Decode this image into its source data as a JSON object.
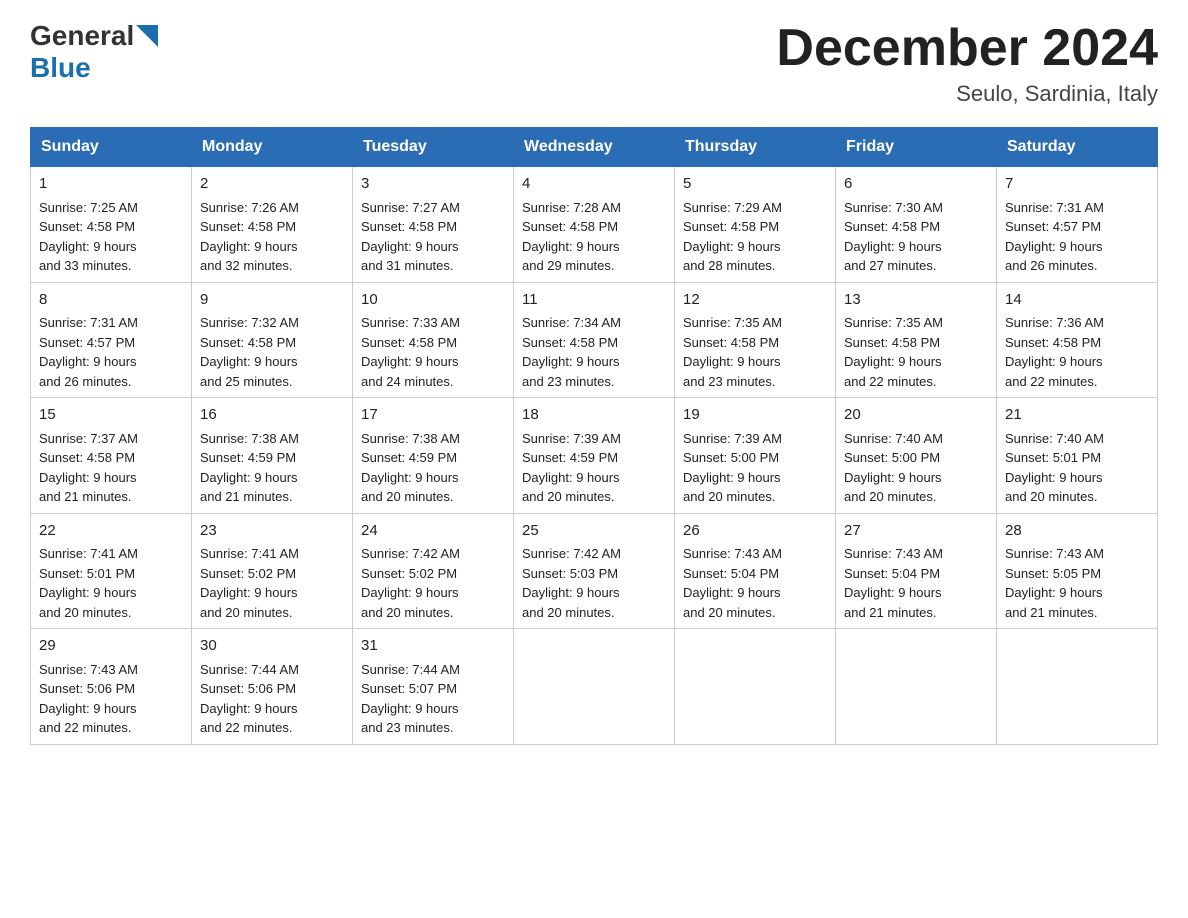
{
  "logo": {
    "general": "General",
    "blue": "Blue",
    "arrow": "▶"
  },
  "title": "December 2024",
  "location": "Seulo, Sardinia, Italy",
  "days_of_week": [
    "Sunday",
    "Monday",
    "Tuesday",
    "Wednesday",
    "Thursday",
    "Friday",
    "Saturday"
  ],
  "weeks": [
    [
      {
        "num": "1",
        "sunrise": "7:25 AM",
        "sunset": "4:58 PM",
        "daylight": "9 hours and 33 minutes."
      },
      {
        "num": "2",
        "sunrise": "7:26 AM",
        "sunset": "4:58 PM",
        "daylight": "9 hours and 32 minutes."
      },
      {
        "num": "3",
        "sunrise": "7:27 AM",
        "sunset": "4:58 PM",
        "daylight": "9 hours and 31 minutes."
      },
      {
        "num": "4",
        "sunrise": "7:28 AM",
        "sunset": "4:58 PM",
        "daylight": "9 hours and 29 minutes."
      },
      {
        "num": "5",
        "sunrise": "7:29 AM",
        "sunset": "4:58 PM",
        "daylight": "9 hours and 28 minutes."
      },
      {
        "num": "6",
        "sunrise": "7:30 AM",
        "sunset": "4:58 PM",
        "daylight": "9 hours and 27 minutes."
      },
      {
        "num": "7",
        "sunrise": "7:31 AM",
        "sunset": "4:57 PM",
        "daylight": "9 hours and 26 minutes."
      }
    ],
    [
      {
        "num": "8",
        "sunrise": "7:31 AM",
        "sunset": "4:57 PM",
        "daylight": "9 hours and 26 minutes."
      },
      {
        "num": "9",
        "sunrise": "7:32 AM",
        "sunset": "4:58 PM",
        "daylight": "9 hours and 25 minutes."
      },
      {
        "num": "10",
        "sunrise": "7:33 AM",
        "sunset": "4:58 PM",
        "daylight": "9 hours and 24 minutes."
      },
      {
        "num": "11",
        "sunrise": "7:34 AM",
        "sunset": "4:58 PM",
        "daylight": "9 hours and 23 minutes."
      },
      {
        "num": "12",
        "sunrise": "7:35 AM",
        "sunset": "4:58 PM",
        "daylight": "9 hours and 23 minutes."
      },
      {
        "num": "13",
        "sunrise": "7:35 AM",
        "sunset": "4:58 PM",
        "daylight": "9 hours and 22 minutes."
      },
      {
        "num": "14",
        "sunrise": "7:36 AM",
        "sunset": "4:58 PM",
        "daylight": "9 hours and 22 minutes."
      }
    ],
    [
      {
        "num": "15",
        "sunrise": "7:37 AM",
        "sunset": "4:58 PM",
        "daylight": "9 hours and 21 minutes."
      },
      {
        "num": "16",
        "sunrise": "7:38 AM",
        "sunset": "4:59 PM",
        "daylight": "9 hours and 21 minutes."
      },
      {
        "num": "17",
        "sunrise": "7:38 AM",
        "sunset": "4:59 PM",
        "daylight": "9 hours and 20 minutes."
      },
      {
        "num": "18",
        "sunrise": "7:39 AM",
        "sunset": "4:59 PM",
        "daylight": "9 hours and 20 minutes."
      },
      {
        "num": "19",
        "sunrise": "7:39 AM",
        "sunset": "5:00 PM",
        "daylight": "9 hours and 20 minutes."
      },
      {
        "num": "20",
        "sunrise": "7:40 AM",
        "sunset": "5:00 PM",
        "daylight": "9 hours and 20 minutes."
      },
      {
        "num": "21",
        "sunrise": "7:40 AM",
        "sunset": "5:01 PM",
        "daylight": "9 hours and 20 minutes."
      }
    ],
    [
      {
        "num": "22",
        "sunrise": "7:41 AM",
        "sunset": "5:01 PM",
        "daylight": "9 hours and 20 minutes."
      },
      {
        "num": "23",
        "sunrise": "7:41 AM",
        "sunset": "5:02 PM",
        "daylight": "9 hours and 20 minutes."
      },
      {
        "num": "24",
        "sunrise": "7:42 AM",
        "sunset": "5:02 PM",
        "daylight": "9 hours and 20 minutes."
      },
      {
        "num": "25",
        "sunrise": "7:42 AM",
        "sunset": "5:03 PM",
        "daylight": "9 hours and 20 minutes."
      },
      {
        "num": "26",
        "sunrise": "7:43 AM",
        "sunset": "5:04 PM",
        "daylight": "9 hours and 20 minutes."
      },
      {
        "num": "27",
        "sunrise": "7:43 AM",
        "sunset": "5:04 PM",
        "daylight": "9 hours and 21 minutes."
      },
      {
        "num": "28",
        "sunrise": "7:43 AM",
        "sunset": "5:05 PM",
        "daylight": "9 hours and 21 minutes."
      }
    ],
    [
      {
        "num": "29",
        "sunrise": "7:43 AM",
        "sunset": "5:06 PM",
        "daylight": "9 hours and 22 minutes."
      },
      {
        "num": "30",
        "sunrise": "7:44 AM",
        "sunset": "5:06 PM",
        "daylight": "9 hours and 22 minutes."
      },
      {
        "num": "31",
        "sunrise": "7:44 AM",
        "sunset": "5:07 PM",
        "daylight": "9 hours and 23 minutes."
      },
      null,
      null,
      null,
      null
    ]
  ]
}
